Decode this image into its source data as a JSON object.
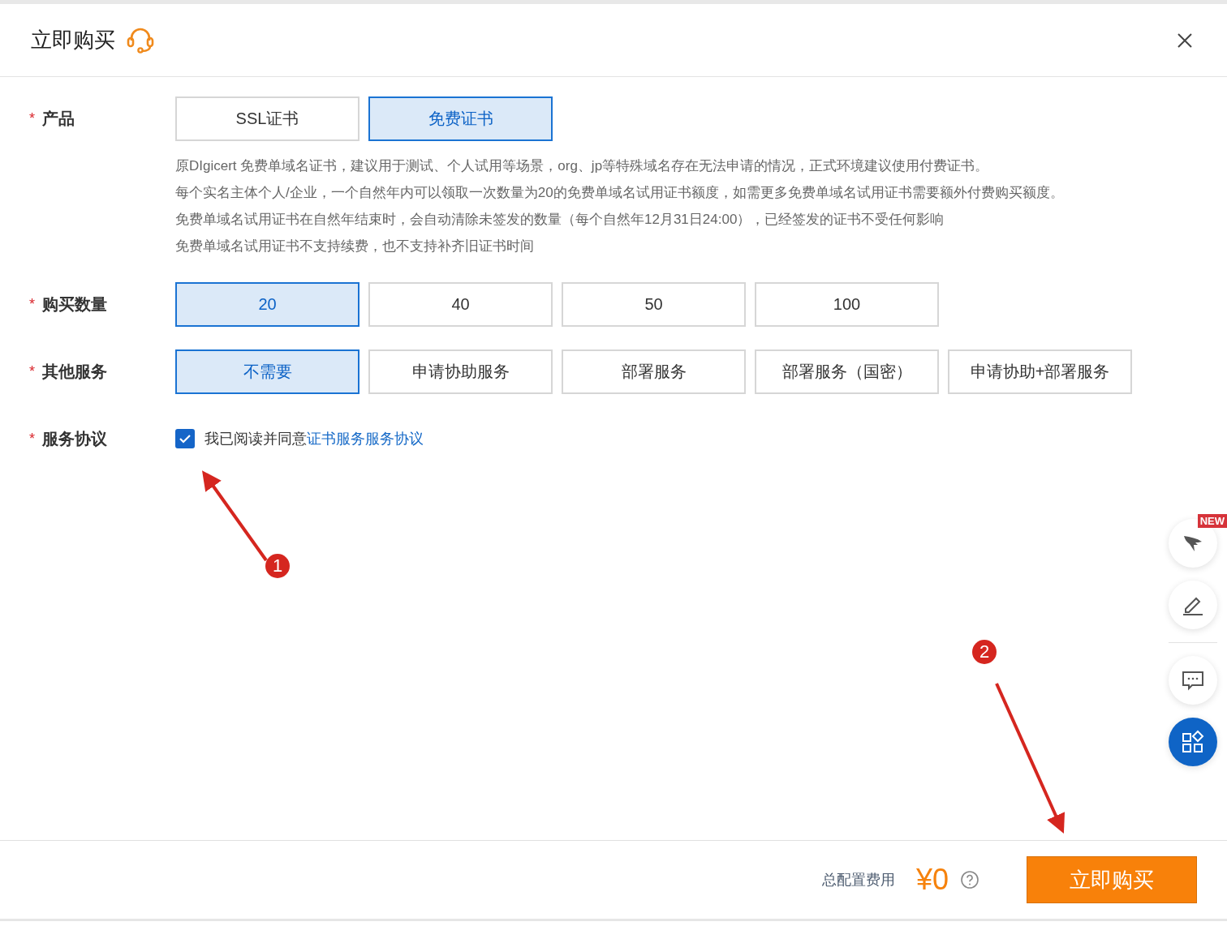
{
  "dialog": {
    "title": "立即购买"
  },
  "form": {
    "rows": [
      {
        "label": "产品",
        "required_mark": "*",
        "kind": "options",
        "options": [
          {
            "label": "SSL证书",
            "selected": false
          },
          {
            "label": "免费证书",
            "selected": true
          }
        ],
        "notes": [
          "原DIgicert 免费单域名证书，建议用于测试、个人试用等场景，org、jp等特殊域名存在无法申请的情况，正式环境建议使用付费证书。",
          "每个实名主体个人/企业，一个自然年内可以领取一次数量为20的免费单域名试用证书额度，如需更多免费单域名试用证书需要额外付费购买额度。",
          "免费单域名试用证书在自然年结束时，会自动清除未签发的数量（每个自然年12月31日24:00），已经签发的证书不受任何影响",
          "免费单域名试用证书不支持续费，也不支持补齐旧证书时间"
        ]
      },
      {
        "label": "购买数量",
        "required_mark": "*",
        "kind": "options",
        "options": [
          {
            "label": "20",
            "selected": true
          },
          {
            "label": "40",
            "selected": false
          },
          {
            "label": "50",
            "selected": false
          },
          {
            "label": "100",
            "selected": false
          }
        ]
      },
      {
        "label": "其他服务",
        "required_mark": "*",
        "kind": "options",
        "options": [
          {
            "label": "不需要",
            "selected": true
          },
          {
            "label": "申请协助服务",
            "selected": false
          },
          {
            "label": "部署服务",
            "selected": false
          },
          {
            "label": "部署服务（国密）",
            "selected": false
          },
          {
            "label": "申请协助+部署服务",
            "selected": false
          }
        ]
      },
      {
        "label": "服务协议",
        "required_mark": "*",
        "kind": "agreement",
        "checked": true,
        "text": "我已阅读并同意",
        "link": "证书服务服务协议"
      }
    ]
  },
  "side_tools": {
    "badge": "NEW"
  },
  "annotations": [
    "1",
    "2"
  ],
  "footer": {
    "cost_label": "总配置费用",
    "price": "¥0",
    "button": "立即购买"
  }
}
